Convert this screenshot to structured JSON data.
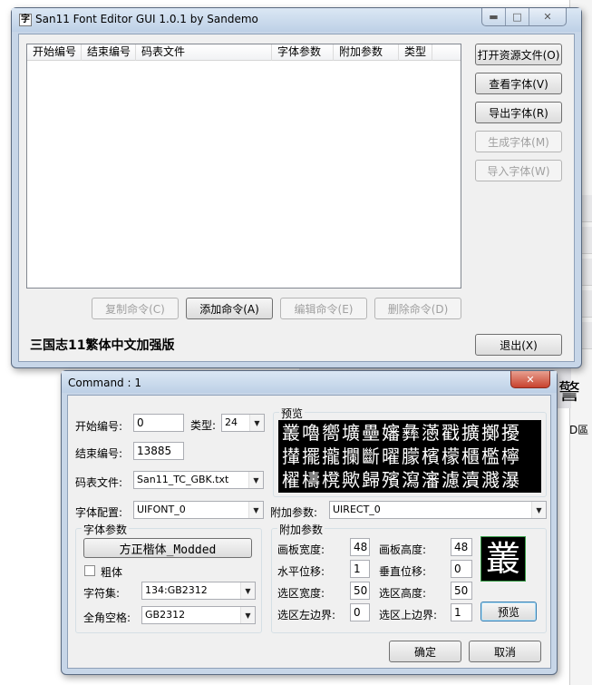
{
  "main_window": {
    "title": "San11 Font Editor GUI 1.0.1 by Sandemo",
    "icon_glyph": "字",
    "columns": [
      "开始编号",
      "结束编号",
      "码表文件",
      "字体参数",
      "附加参数",
      "类型"
    ],
    "buttons": {
      "open_resource": "打开资源文件(O)",
      "view_font": "查看字体(V)",
      "export_font": "导出字体(R)",
      "generate_font": "生成字体(M)",
      "import_font": "导入字体(W)",
      "copy_command": "复制命令(C)",
      "add_command": "添加命令(A)",
      "edit_command": "编辑命令(E)",
      "delete_command": "删除命令(D)",
      "exit": "退出(X)"
    },
    "status_text": "三国志11繁体中文加强版"
  },
  "background": {
    "right_text": "D區",
    "right_glyph": "警"
  },
  "dialog": {
    "title": "Command : 1",
    "close_glyph": "✕",
    "start_label": "开始编号:",
    "start_value": "0",
    "type_label": "类型:",
    "type_value": "24",
    "end_label": "结束编号:",
    "end_value": "13885",
    "codetable_label": "码表文件:",
    "codetable_value": "San11_TC_GBK.txt",
    "font_config_label": "字体配置:",
    "font_config_value": "UIFONT_0",
    "extra_param_label": "附加参数:",
    "extra_param_value": "UIRECT_0",
    "preview_group": "预览",
    "preview_lines": [
      "叢嚕嚮壙壘嬸彝懣戳擴擲擾",
      "攆擺攏攔斷曜朦檳檬櫃檻檸",
      "櫂檮櫈歟歸殯瀉瀋濾瀆濺瀑"
    ],
    "font_params": {
      "group": "字体参数",
      "font_name": "方正楷体_Modded",
      "bold_label": "粗体",
      "charset_label": "字符集:",
      "charset_value": "134:GB2312",
      "fullwidth_label": "全角空格:",
      "fullwidth_value": "GB2312"
    },
    "extra_params": {
      "group": "附加参数",
      "canvas_width_label": "画板宽度:",
      "canvas_width": "48",
      "canvas_height_label": "画板高度:",
      "canvas_height": "48",
      "h_offset_label": "水平位移:",
      "h_offset": "1",
      "v_offset_label": "垂直位移:",
      "v_offset": "0",
      "sel_width_label": "选区宽度:",
      "sel_width": "50",
      "sel_height_label": "选区高度:",
      "sel_height": "50",
      "sel_left_label": "选区左边界:",
      "sel_left": "0",
      "sel_top_label": "选区上边界:",
      "sel_top": "1",
      "preview_button": "预览",
      "glyph": "叢"
    },
    "ok_button": "确定",
    "cancel_button": "取消"
  }
}
